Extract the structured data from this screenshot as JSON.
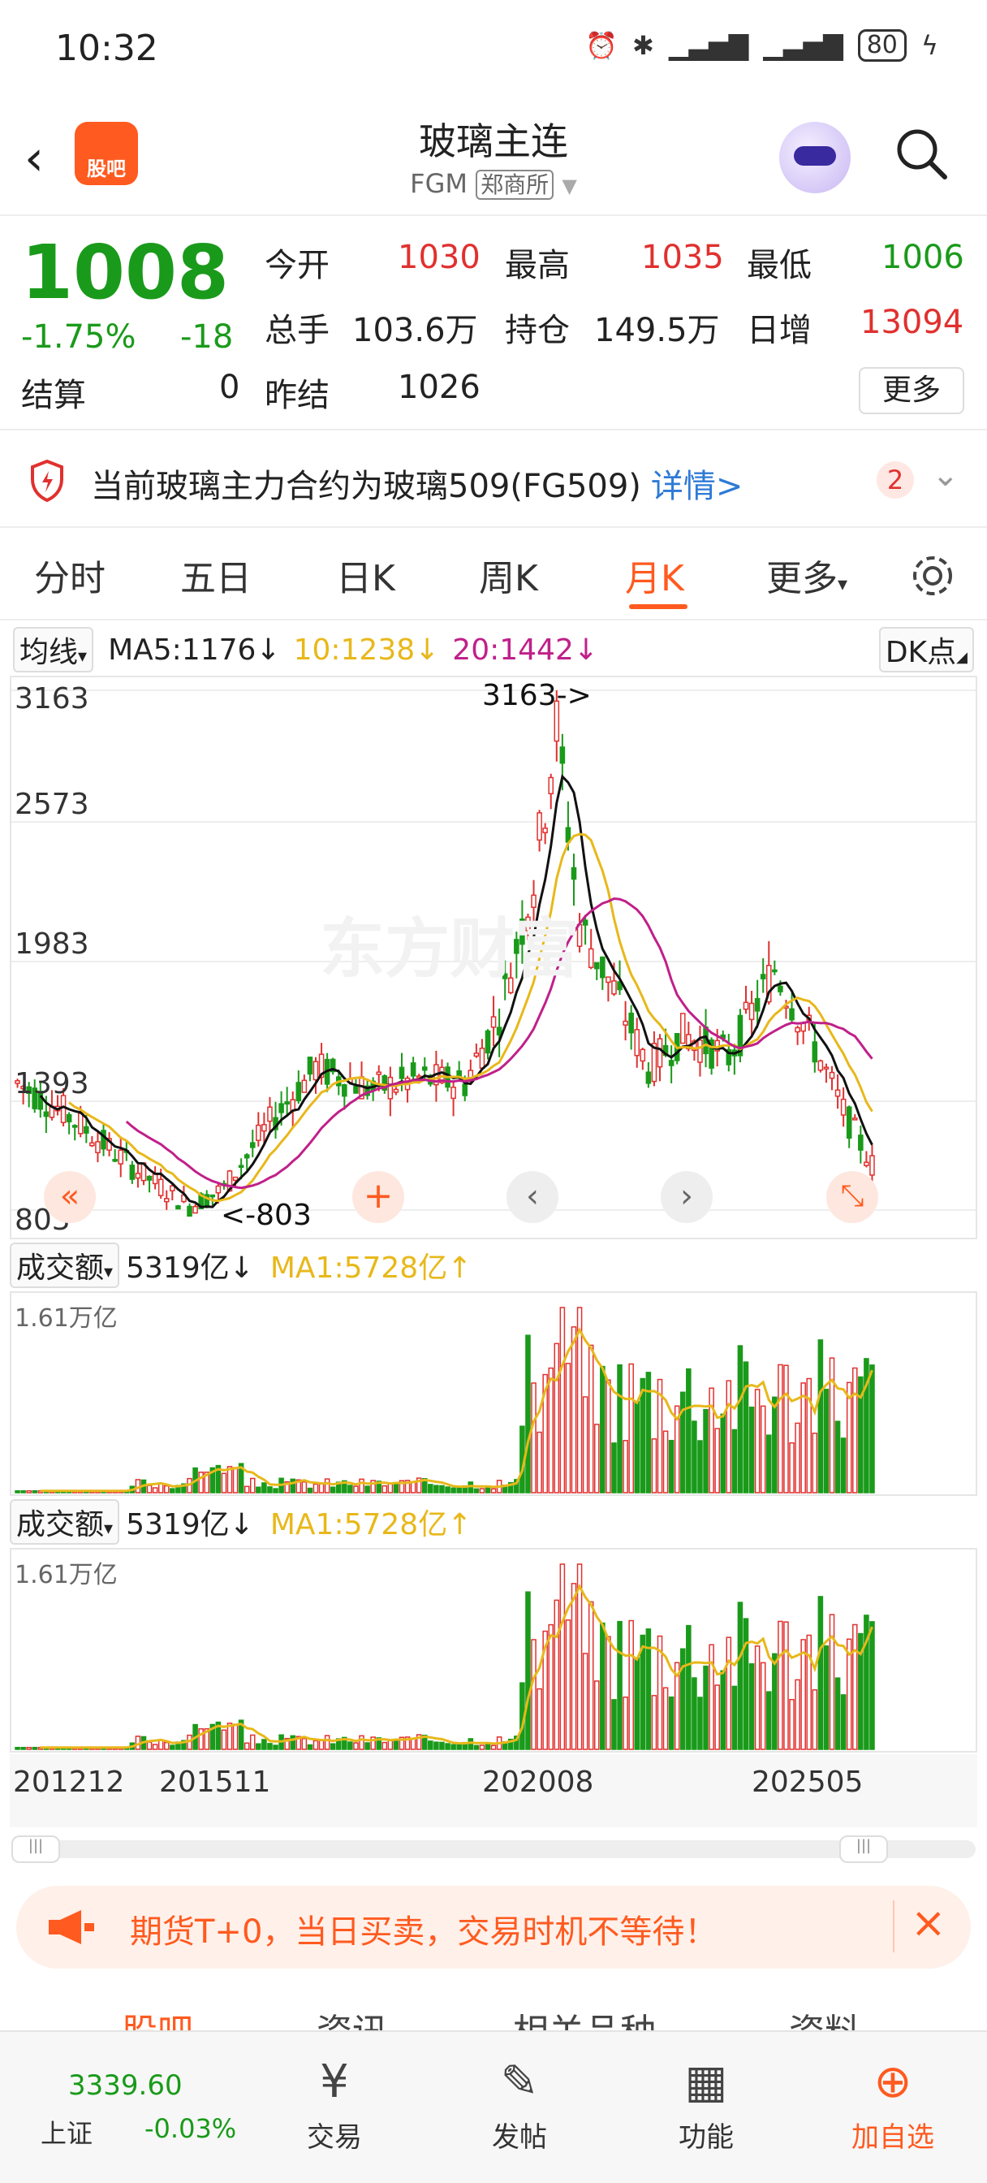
{
  "status": {
    "time": "10:32",
    "battery": "80"
  },
  "header": {
    "title": "玻璃主连",
    "code": "FGM",
    "exchange": "郑商所",
    "guba_logo": "股吧"
  },
  "quote": {
    "price": "1008",
    "pct": "-1.75%",
    "change": "-18",
    "open_label": "今开",
    "open": "1030",
    "high_label": "最高",
    "high": "1035",
    "low_label": "最低",
    "low": "1006",
    "vol_label": "总手",
    "vol": "103.6万",
    "oi_label": "持仓",
    "oi": "149.5万",
    "inc_label": "日增",
    "inc": "13094",
    "settle_label": "结算",
    "settle": "0",
    "prev_label": "昨结",
    "prev": "1026",
    "more": "更多"
  },
  "notice": {
    "text": "当前玻璃主力合约为玻璃509(FG509)",
    "link": "详情>",
    "badge": "2"
  },
  "tabs": [
    "分时",
    "五日",
    "日K",
    "周K",
    "月K",
    "更多"
  ],
  "main_chart": {
    "indicator_label": "均线",
    "ma5": "MA5:1176↓",
    "ma10": "10:1238↓",
    "ma20": "20:1442↓",
    "dk": "DK点",
    "y_ticks": [
      "3163",
      "2573",
      "1983",
      "1393",
      "803"
    ],
    "max_label": "3163->",
    "min_label": "<-803",
    "watermark": "东方财富"
  },
  "sub1": {
    "label": "成交额",
    "value": "5319亿↓",
    "ma": "MA1:5728亿↑",
    "top": "1.61万亿"
  },
  "sub2": {
    "label": "成交额",
    "value": "5319亿↓",
    "ma": "MA1:5728亿↑",
    "top": "1.61万亿"
  },
  "x_axis": [
    "201212",
    "201511",
    "202008",
    "202505"
  ],
  "ad": {
    "text": "期货T+0，当日买卖，交易时机不等待！"
  },
  "subtabs": [
    "股吧",
    "资讯",
    "相关品种",
    "资料"
  ],
  "bottom_nav": {
    "index_value": "3339.60",
    "index_name": "上证",
    "index_change": "-0.03%",
    "trade": "交易",
    "post": "发帖",
    "func": "功能",
    "add": "加自选"
  },
  "colors": {
    "up": "#e0312f",
    "down": "#1a9a1a",
    "accent": "#ff5a1f",
    "ma10": "#e8b81a",
    "ma20": "#c0208a"
  },
  "chart_data": {
    "type": "candlestick",
    "title": "玻璃主连 月K",
    "x_start": "201212",
    "x_end": "202505",
    "ylim": [
      803,
      3163
    ],
    "series": [
      {
        "name": "MA5",
        "last": 1176
      },
      {
        "name": "MA10",
        "last": 1238
      },
      {
        "name": "MA20",
        "last": 1442
      }
    ],
    "high": 3163,
    "low": 803,
    "volume_max": "1.61万亿",
    "volume_last": "5319亿",
    "volume_ma1": "5728亿"
  }
}
